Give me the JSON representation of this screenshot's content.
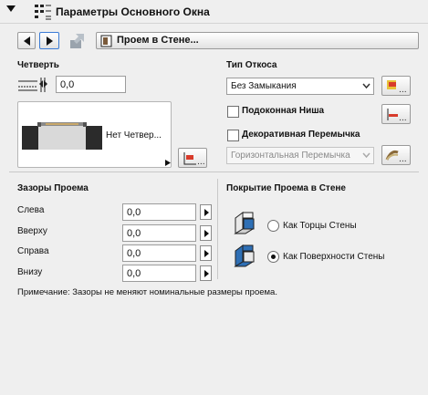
{
  "panel": {
    "title": "Параметры Основного Окна",
    "collapse_icon": "triangle-down-icon",
    "panel_icon": "window-settings-icon"
  },
  "toolbar": {
    "prev_icon": "arrow-left-icon",
    "next_icon": "arrow-right-icon",
    "export_icon": "export-icon",
    "dropdown_icon": "door-opening-icon",
    "dropdown_label": "Проем в Стене..."
  },
  "quarter": {
    "heading": "Четверть",
    "value": "0,0",
    "preview_label": "Нет Четвер..."
  },
  "reveal": {
    "heading": "Тип Откоса",
    "type_value": "Без Замыкания",
    "sill_label": "Подоконная Ниша",
    "sill_checked": false,
    "lintel_label": "Декоративная Перемычка",
    "lintel_checked": false,
    "lintel_type_value": "Горизонтальная Перемычка"
  },
  "gaps": {
    "heading": "Зазоры Проема",
    "rows": [
      {
        "label": "Слева",
        "value": "0,0"
      },
      {
        "label": "Вверху",
        "value": "0,0"
      },
      {
        "label": "Справа",
        "value": "0,0"
      },
      {
        "label": "Внизу",
        "value": "0,0"
      }
    ]
  },
  "coverage": {
    "heading": "Покрытие Проема в Стене",
    "options": [
      {
        "label": "Как Торцы Стены",
        "selected": false
      },
      {
        "label": "Как Поверхности Стены",
        "selected": true
      }
    ]
  },
  "note": "Примечание: Зазоры не меняют номинальные размеры проема.",
  "colors": {
    "background": "#efefef",
    "field_border": "#9c9c9c",
    "icon_red": "#d83b2b",
    "icon_yellow": "#e8c23a"
  }
}
